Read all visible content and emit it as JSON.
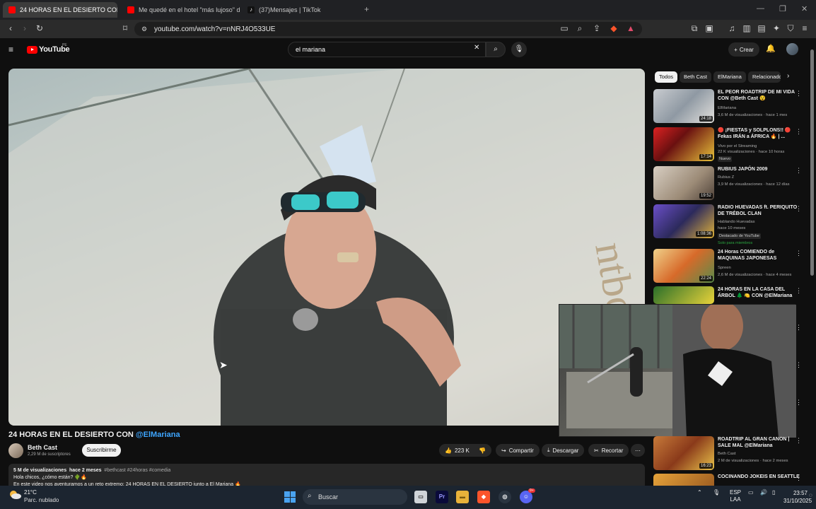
{
  "browser": {
    "tabs": [
      {
        "label": "24 HORAS EN EL DESIERTO CON",
        "active": true
      },
      {
        "label": "Me quedé en el hotel \"más lujoso\" d",
        "active": false
      },
      {
        "label": "(37)Mensajes | TikTok",
        "active": false
      }
    ],
    "new_tab": "+",
    "url": "youtube.com/watch?v=nNRJ4O533UE"
  },
  "youtube": {
    "logo": "YouTube",
    "country_code": "PE",
    "search_value": "el mariana",
    "create_label": "Crear"
  },
  "video": {
    "title_prefix": "24 HORAS EN EL DESIERTO CON ",
    "title_mention": "@ElMariana",
    "channel": "Beth Cast",
    "subscribers": "2,29 M de suscriptores",
    "subscribe_label": "Suscribirme",
    "likes": "223 K",
    "share_label": "Compartir",
    "download_label": "Descargar",
    "clip_label": "Recortar",
    "description": {
      "views": "5 M de visualizaciones",
      "date": "hace 2 meses",
      "tags": "#bethcast #24horas #comedia",
      "line1": "Hola chicos, ¿cómo están? 🌵🔥",
      "line2": "En este video nos aventuramos a un reto extremo: 24 HORAS EN EL DESIERTO junto a El Mariana 🔥"
    }
  },
  "sidebar": {
    "chips": [
      "Todos",
      "Beth Cast",
      "ElMariana",
      "Relacionado"
    ],
    "recommendations": [
      {
        "title": "EL PEOR ROADTRIP DE MI VIDA CON @Beth Cast 😵",
        "channel": "ElMariana",
        "meta": "3,6 M de visualizaciones · hace 1 mes",
        "duration": "24:18"
      },
      {
        "title": "🔴 ¡FIESTAS y SOLPLONS!! 🔴 Fekas IRÁN a ÁFRICA 🔥 | ...",
        "channel": "Vivo por el Streaming",
        "meta": "22 K visualizaciones · hace 10 horas",
        "duration": "17:14",
        "badge": "Nuevo"
      },
      {
        "title": "RUBIUS JAPÓN 2009",
        "channel": "Rubius Z",
        "meta": "3,9 M de visualizaciones · hace 12 días",
        "duration": "19:52"
      },
      {
        "title": "RADIO HUEVADAS ft. PERIQUITO DE TRÉBOL CLAN",
        "channel": "Hablando Huevadas",
        "meta": "hace 10 meses",
        "duration": "1:08:36",
        "badge": "Destacado de YouTube",
        "badge2": "Solo para miembros"
      },
      {
        "title": "24 Horas COMIENDO de MAQUINAS JAPONESAS",
        "channel": "Spreen",
        "meta": "2,6 M de visualizaciones · hace 4 meses",
        "duration": "22:24"
      },
      {
        "title": "24 HORAS EN LA CASA DEL ÁRBOL 🌲 🍋 CON @ElMariana",
        "channel": "",
        "meta": "",
        "duration": ""
      },
      {
        "title": "ROADTRIP AL GRAN CANON | SALE MAL @ElMariana",
        "channel": "Beth Cast",
        "meta": "2 M de visualizaciones · hace 2 meses",
        "duration": "16:23"
      },
      {
        "title": "COCINANDO JOKEIS EN SEATTLE",
        "channel": "",
        "meta": "",
        "duration": ""
      }
    ]
  },
  "taskbar": {
    "temperature": "21°C",
    "condition": "Parc. nublado",
    "search_label": "Buscar",
    "language": "ESP",
    "language_sub": "LAA",
    "time": "23:57",
    "date": "31/10/2025",
    "discord_badge": "9+"
  }
}
